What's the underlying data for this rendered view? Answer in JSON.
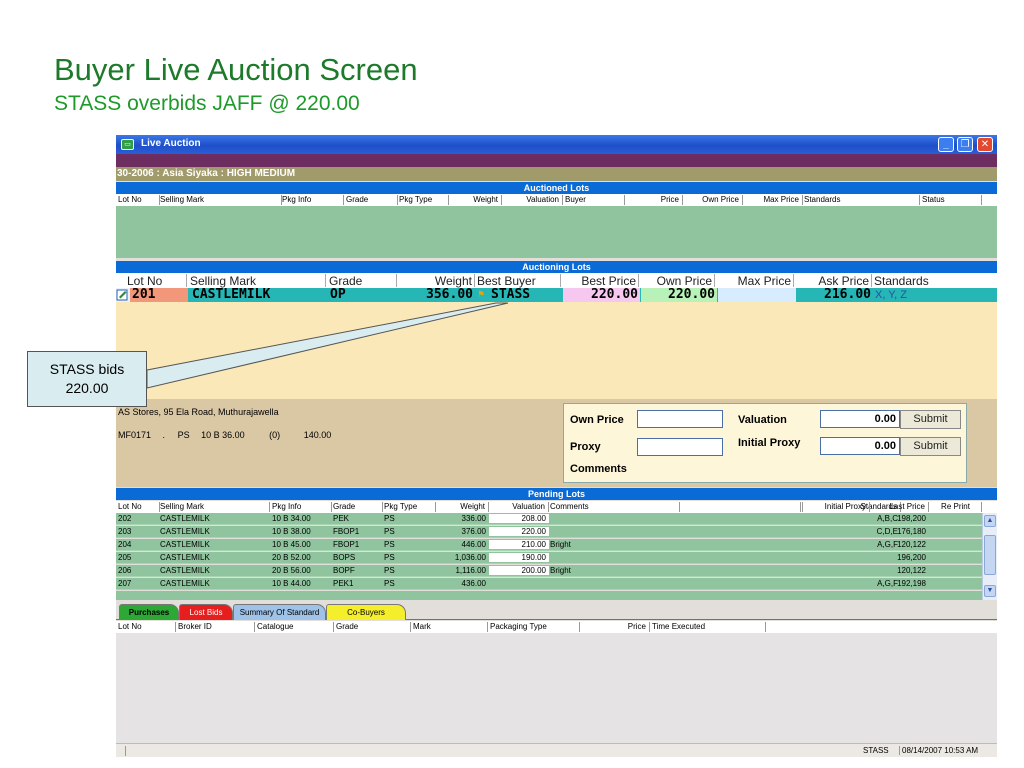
{
  "slide": {
    "title": "Buyer Live Auction Screen",
    "subtitle": "STASS overbids JAFF @ 220.00"
  },
  "window": {
    "title": "Live Auction",
    "sale_info": "30-2006 : Asia Siyaka : HIGH MEDIUM",
    "controls": [
      "minimize-icon",
      "restore-icon",
      "close-icon"
    ]
  },
  "auctioned_lots": {
    "header": "Auctioned Lots",
    "columns": [
      "Lot No",
      "Selling Mark",
      "Pkg Info",
      "Grade",
      "Pkg Type",
      "Weight",
      "Valuation",
      "Buyer",
      "Price",
      "Own Price",
      "Max Price",
      "Standards",
      "Status"
    ]
  },
  "auctioning_lots": {
    "header": "Auctioning Lots",
    "columns": [
      "Lot No",
      "Selling Mark",
      "Grade",
      "Weight",
      "Best Buyer",
      "Best Price",
      "Own Price",
      "Max Price",
      "Ask Price",
      "Standards"
    ],
    "row": {
      "lot_no": "201",
      "selling_mark": "CASTLEMILK",
      "grade": "OP",
      "weight": "356.00",
      "best_buyer": "STASS",
      "best_price": "220.00",
      "own_price": "220.00",
      "max_price": "",
      "ask_price": "216.00",
      "standards": "X, Y, Z"
    }
  },
  "lot_details": {
    "address": "AS Stores, 95 Ela Road, Muthurajawella",
    "line2": [
      "MF0171",
      ".",
      "PS",
      "10 B 36.00",
      "(0)",
      "140.00"
    ]
  },
  "bid_form": {
    "own_price_label": "Own Price",
    "own_price_value": "",
    "valuation_label": "Valuation",
    "valuation_value": "0.00",
    "proxy_label": "Proxy",
    "proxy_value": "",
    "initial_proxy_label": "Initial Proxy",
    "initial_proxy_value": "0.00",
    "comments_label": "Comments",
    "submit_label": "Submit"
  },
  "pending_lots": {
    "header": "Pending Lots",
    "columns": [
      "Lot No",
      "Selling Mark",
      "Pkg Info",
      "Grade",
      "Pkg Type",
      "Weight",
      "Valuation",
      "Comments",
      "Standards",
      "Initial Proxy",
      "Last Price",
      "Re Print"
    ],
    "rows": [
      {
        "lot": "202",
        "mark": "CASTLEMILK",
        "pkg": "10 B 34.00",
        "grade": "PEK",
        "type": "PS",
        "weight": "336.00",
        "valuation": "208.00",
        "comments": "",
        "standards": "A,B,C",
        "proxy": "",
        "last": "198,200"
      },
      {
        "lot": "203",
        "mark": "CASTLEMILK",
        "pkg": "10 B 38.00",
        "grade": "FBOP1",
        "type": "PS",
        "weight": "376.00",
        "valuation": "220.00",
        "comments": "",
        "standards": "C,D,E",
        "proxy": "",
        "last": "176,180"
      },
      {
        "lot": "204",
        "mark": "CASTLEMILK",
        "pkg": "10 B 45.00",
        "grade": "FBOP1",
        "type": "PS",
        "weight": "446.00",
        "valuation": "210.00",
        "comments": "Bright",
        "standards": "A,G,F",
        "proxy": "",
        "last": "120,122"
      },
      {
        "lot": "205",
        "mark": "CASTLEMILK",
        "pkg": "20 B 52.00",
        "grade": "BOPS",
        "type": "PS",
        "weight": "1,036.00",
        "valuation": "190.00",
        "comments": "",
        "standards": "",
        "proxy": "",
        "last": "196,200"
      },
      {
        "lot": "206",
        "mark": "CASTLEMILK",
        "pkg": "20 B 56.00",
        "grade": "BOPF",
        "type": "PS",
        "weight": "1,116.00",
        "valuation": "200.00",
        "comments": "Bright",
        "standards": "",
        "proxy": "",
        "last": "120,122"
      },
      {
        "lot": "207",
        "mark": "CASTLEMILK",
        "pkg": "10 B 44.00",
        "grade": "PEK1",
        "type": "PS",
        "weight": "436.00",
        "valuation": "",
        "comments": "",
        "standards": "A,G,F",
        "proxy": "",
        "last": "192,198"
      }
    ]
  },
  "tabs": [
    "Purchases",
    "Lost Bids",
    "Summary Of Standard",
    "Co-Buyers"
  ],
  "purchases_columns": [
    "Lot No",
    "Broker ID",
    "Catalogue",
    "Grade",
    "Mark",
    "Packaging Type",
    "Price",
    "Time Executed"
  ],
  "status_bar": {
    "user": "STASS",
    "datetime": "08/14/2007 10:53 AM"
  },
  "callout": {
    "line1": "STASS bids",
    "line2": "220.00"
  },
  "colors": {
    "title_green": "#1d7a2a",
    "section_blue": "#0a6bd6",
    "grid_green": "#8fc49e",
    "auction_row_teal": "#26b6b6"
  }
}
